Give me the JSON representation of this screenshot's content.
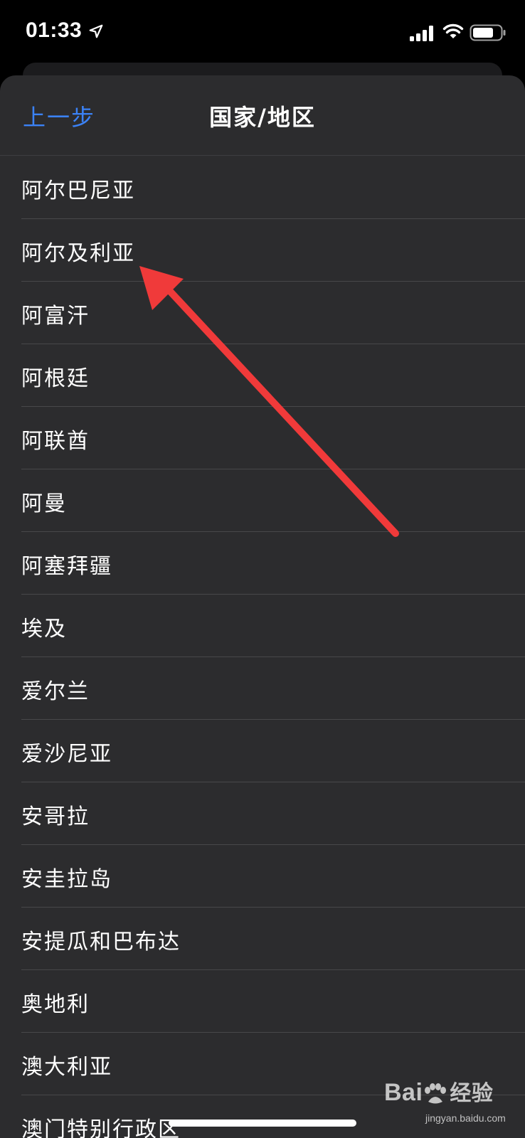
{
  "status_bar": {
    "time": "01:33",
    "location_icon": "location-arrow-icon",
    "signal_icon": "cellular-signal-icon",
    "wifi_icon": "wifi-icon",
    "battery_icon": "battery-icon"
  },
  "nav": {
    "back_label": "上一步",
    "title": "国家/地区"
  },
  "regions": [
    "阿尔巴尼亚",
    "阿尔及利亚",
    "阿富汗",
    "阿根廷",
    "阿联酋",
    "阿曼",
    "阿塞拜疆",
    "埃及",
    "爱尔兰",
    "爱沙尼亚",
    "安哥拉",
    "安圭拉岛",
    "安提瓜和巴布达",
    "奥地利",
    "澳大利亚",
    "澳门特别行政区"
  ],
  "annotation": {
    "type": "red-arrow-icon",
    "color": "#f03a3a",
    "points_to": "阿尔及利亚"
  },
  "watermark": {
    "brand": "Bai",
    "brand_suffix": "经验",
    "url": "jingyan.baidu.com"
  },
  "colors": {
    "background": "#000000",
    "sheet": "#2c2c2e",
    "accent": "#3b82f6",
    "separator": "#48484a",
    "annotation": "#f03a3a"
  }
}
